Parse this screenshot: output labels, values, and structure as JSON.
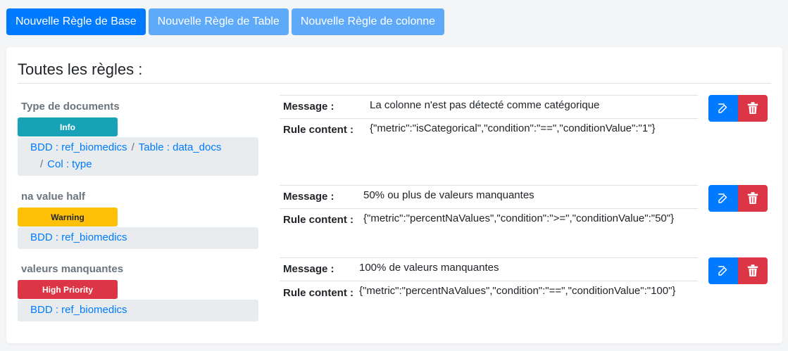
{
  "toolbar": {
    "new_base_rule": "Nouvelle Règle de Base",
    "new_table_rule": "Nouvelle Règle de Table",
    "new_column_rule": "Nouvelle Règle de colonne"
  },
  "card": {
    "title": "Toutes les règles :"
  },
  "labels": {
    "message": "Message :",
    "rule_content": "Rule content :"
  },
  "rules": [
    {
      "name": "Type de documents",
      "priority": "Info",
      "bdd": "BDD : ref_biomedics",
      "table": "Table : data_docs",
      "col": "Col : type",
      "message": "La colonne n'est pas détecté comme catégorique",
      "content": "{\"metric\":\"isCategorical\",\"condition\":\"==\",\"conditionValue\":\"1\"}"
    },
    {
      "name": "na value half",
      "priority": "Warning",
      "bdd": "BDD : ref_biomedics",
      "message": "50% ou plus de valeurs manquantes",
      "content": "{\"metric\":\"percentNaValues\",\"condition\":\">=\",\"conditionValue\":\"50\"}"
    },
    {
      "name": "valeurs manquantes",
      "priority": "High Priority",
      "bdd": "BDD : ref_biomedics",
      "message": "100% de valeurs manquantes",
      "content": "{\"metric\":\"percentNaValues\",\"condition\":\"==\",\"conditionValue\":\"100\"}"
    }
  ],
  "colors": {
    "primary": "#007bff",
    "info": "#17a2b8",
    "warning": "#ffc107",
    "danger": "#dc3545"
  },
  "icons": {
    "edit": "edit-icon",
    "delete": "trash-icon"
  }
}
